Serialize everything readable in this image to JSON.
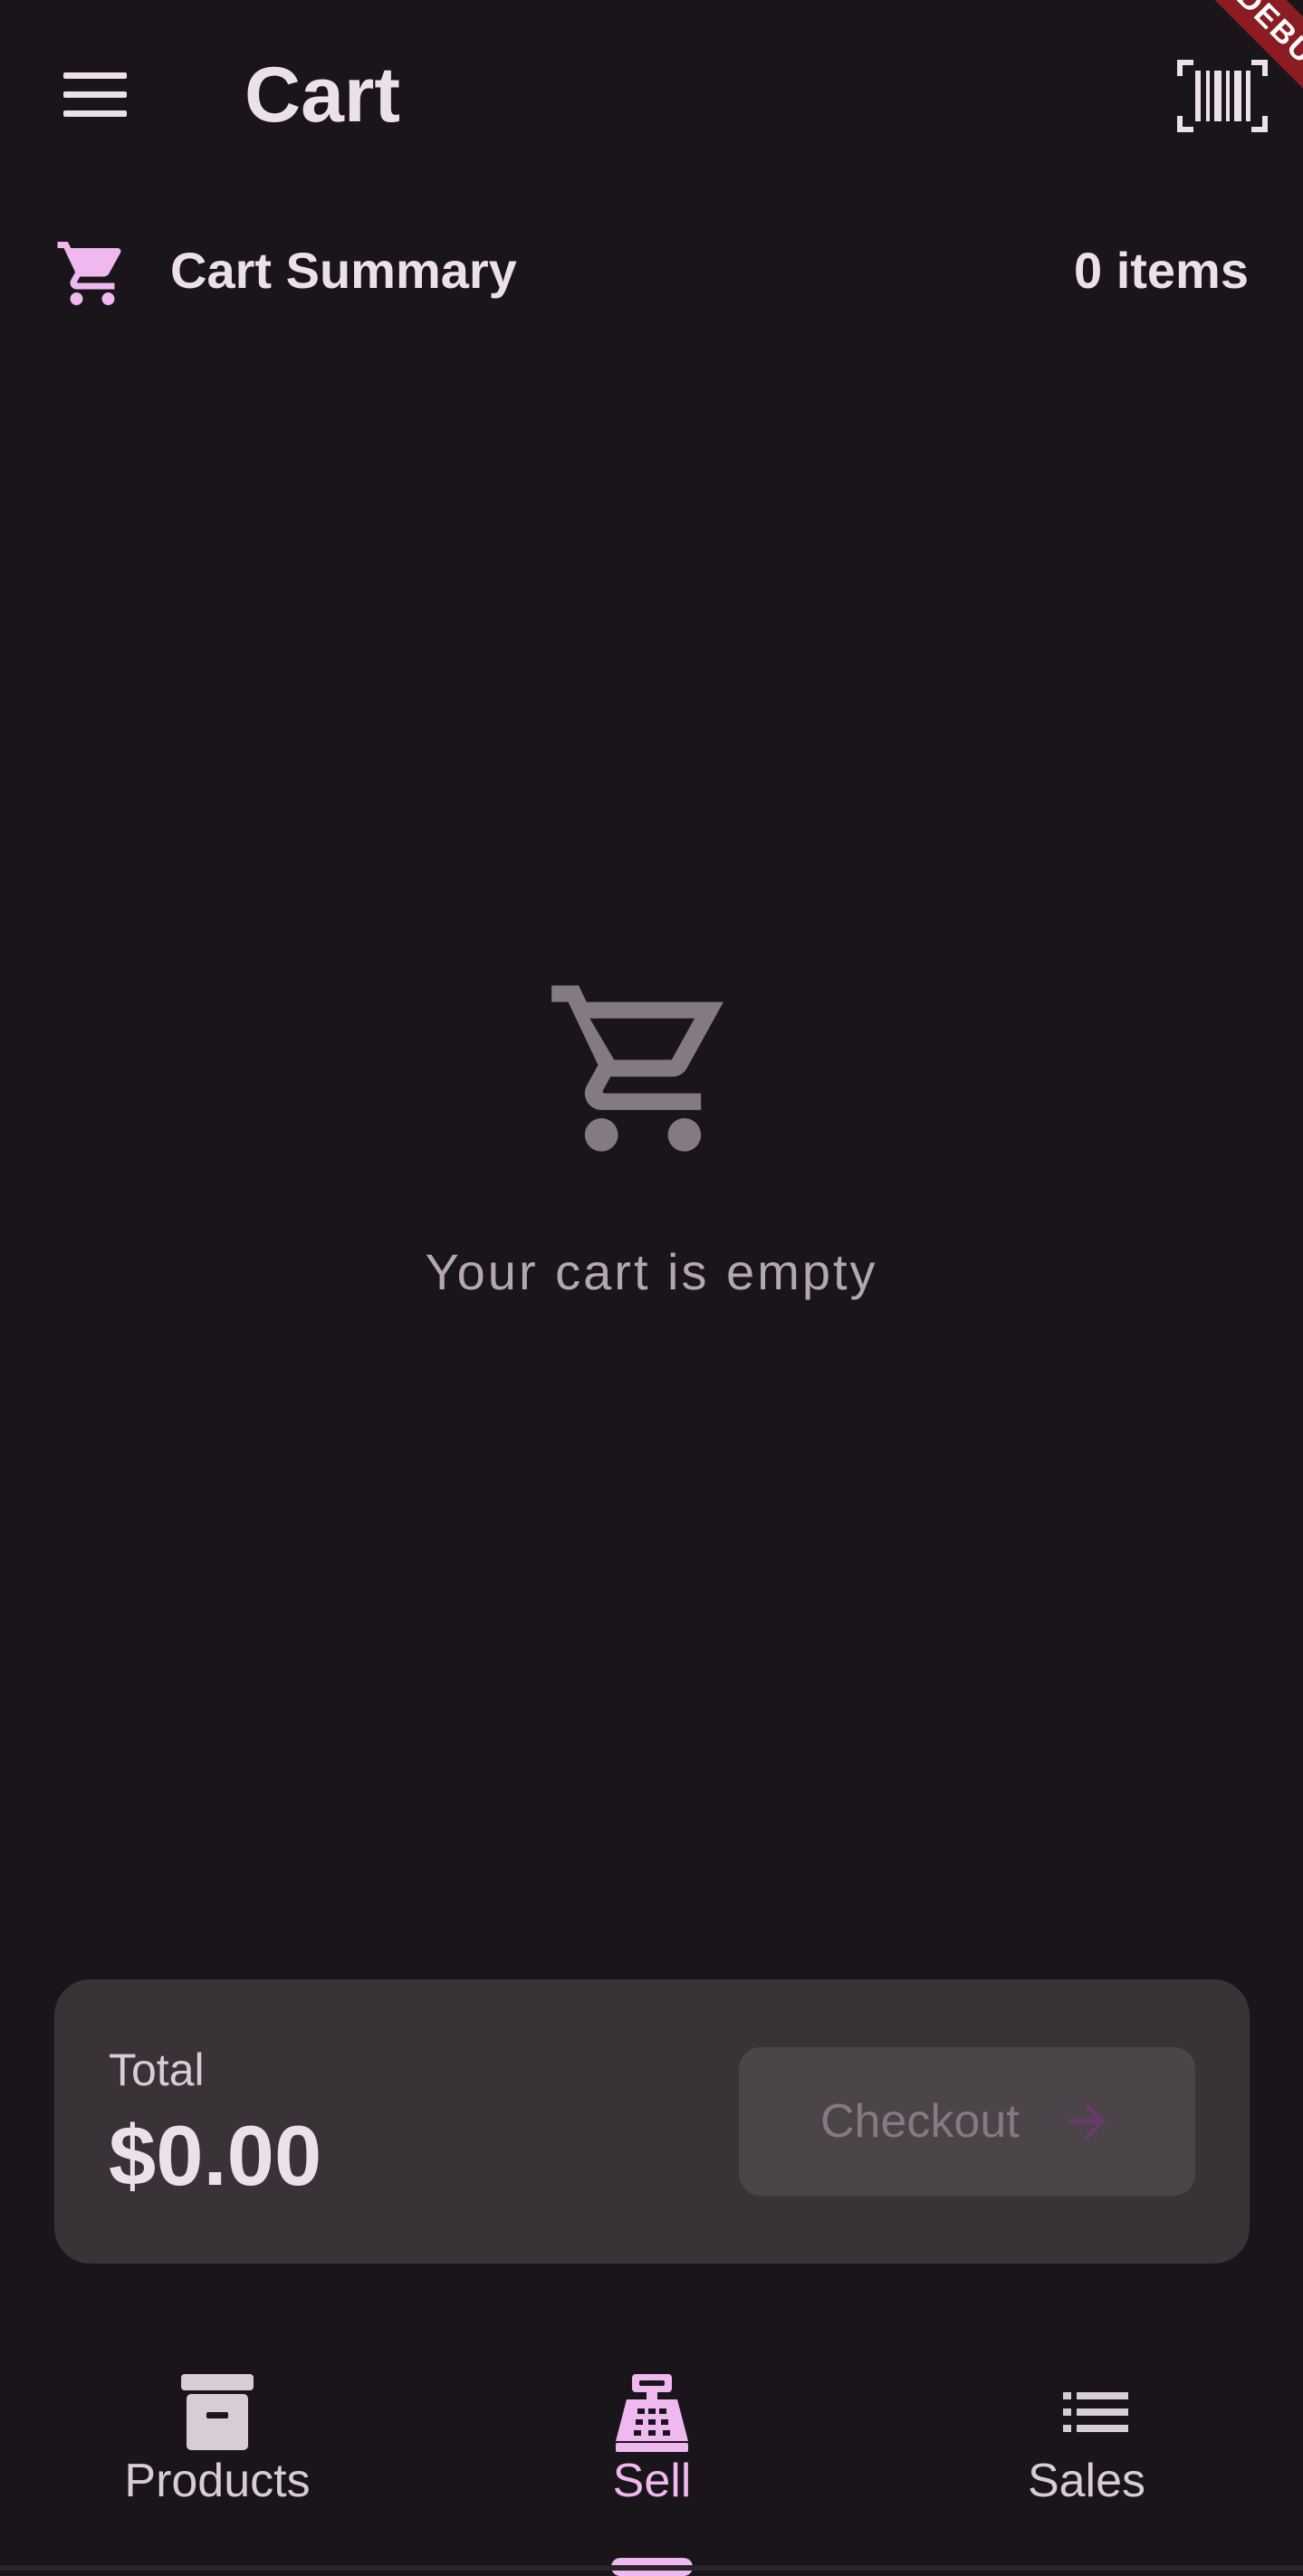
{
  "app_bar": {
    "title": "Cart",
    "menu_icon": "hamburger-menu-icon",
    "scan_icon": "barcode-scanner-icon"
  },
  "debug_banner": {
    "text": "DEBUG"
  },
  "summary": {
    "icon": "shopping-cart-icon",
    "label": "Cart Summary",
    "count": "0 items"
  },
  "empty_state": {
    "icon": "shopping-cart-icon",
    "message": "Your cart is empty"
  },
  "total": {
    "label": "Total",
    "amount": "$0.00",
    "checkout_label": "Checkout",
    "checkout_icon": "arrow-forward-icon",
    "checkout_enabled": false
  },
  "bottom_nav": {
    "items": [
      {
        "label": "Products",
        "icon": "archive-box-icon",
        "active": false
      },
      {
        "label": "Sell",
        "icon": "cash-register-icon",
        "active": true
      },
      {
        "label": "Sales",
        "icon": "list-icon",
        "active": false
      }
    ]
  },
  "colors": {
    "background": "#1a151a",
    "accent": "#efb8ef",
    "text": "#ece0ea",
    "card": "#393337",
    "debug_banner": "#8a1c22"
  }
}
